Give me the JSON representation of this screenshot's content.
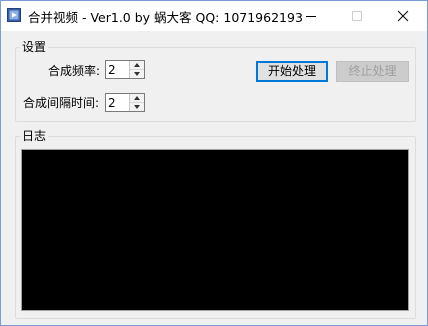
{
  "window": {
    "title": "合并视频 - Ver1.0 by 蜗大客 QQ:  1071962193"
  },
  "settings": {
    "group_label": "设置",
    "frequency_label": "合成频率:",
    "frequency_value": "2",
    "interval_label": "合成间隔时间:",
    "interval_value": "2",
    "start_button": "开始处理",
    "stop_button": "终止处理"
  },
  "log": {
    "group_label": "日志",
    "content": ""
  },
  "colors": {
    "log_background": "#000000",
    "accent": "#0078d7"
  }
}
